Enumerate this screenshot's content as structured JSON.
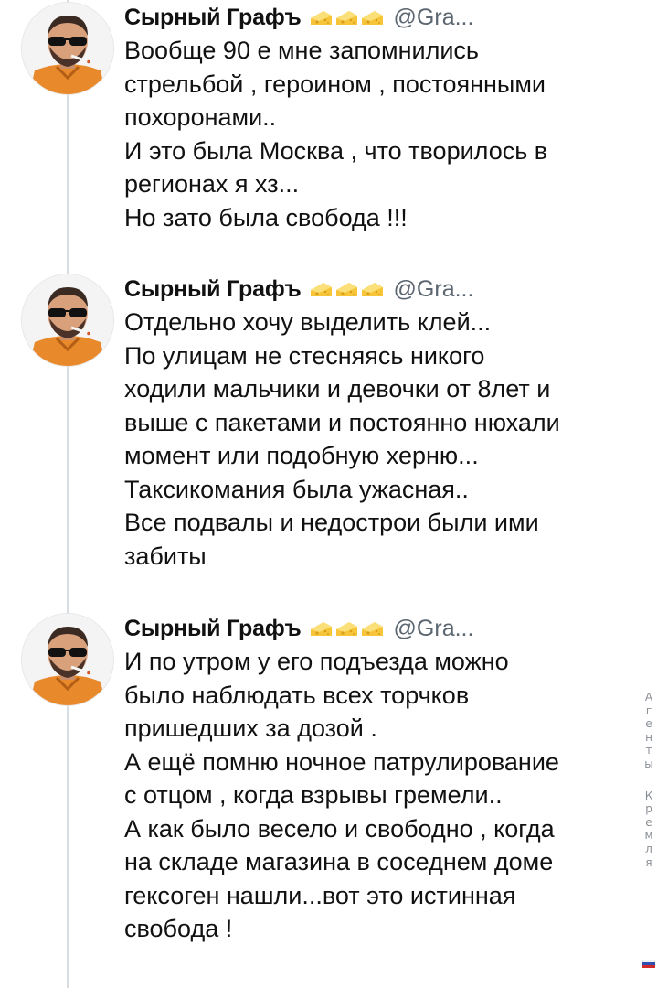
{
  "tweets": [
    {
      "name": "Сырный Графъ",
      "handle": "@Gra...",
      "text": "Вообще  90 е мне запомнились\nстрельбой , героином , постоянными\nпохоронами..\nИ это была Москва , что творилось в\nрегионах я хз...\nНо зато  была свобода !!!"
    },
    {
      "name": "Сырный Графъ",
      "handle": "@Gra...",
      "text": "Отдельно хочу выделить клей...\nПо улицам не стесняясь никого\nходили мальчики и девочки от 8лет и\nвыше с пакетами и постоянно нюхали\nмомент или подобную херню...\nТаксикомания была ужасная..\nВсе подвалы и недострои были ими\nзабиты"
    },
    {
      "name": "Сырный Графъ",
      "handle": "@Gra...",
      "text": "И  по утром у его подъезда можно\nбыло наблюдать всех торчков\nпришедших за дозой .\nА ещё помню ночное патрулирование\nс отцом , когда взрывы гремели..\nА как было весело и свободно , когда\nна складе магазина в соседнем доме\nгексоген нашли...вот это истинная\nсвобода !"
    }
  ],
  "icons": {
    "name_badges": [
      "cheese-icon",
      "cheese-icon",
      "cheese-icon"
    ],
    "avatar": "avatar-man-sunglasses-cigarette",
    "flag": "russia-flag-icon"
  },
  "watermark": {
    "word1": [
      "А",
      "г",
      "е",
      "н",
      "т",
      "ы"
    ],
    "word2": [
      "К",
      "р",
      "е",
      "м",
      "л",
      "я"
    ]
  },
  "colors": {
    "thread_line": "#d8dde1",
    "handle": "#5b6670",
    "cheese": "#f6c53a",
    "shirt": "#e8892c"
  }
}
